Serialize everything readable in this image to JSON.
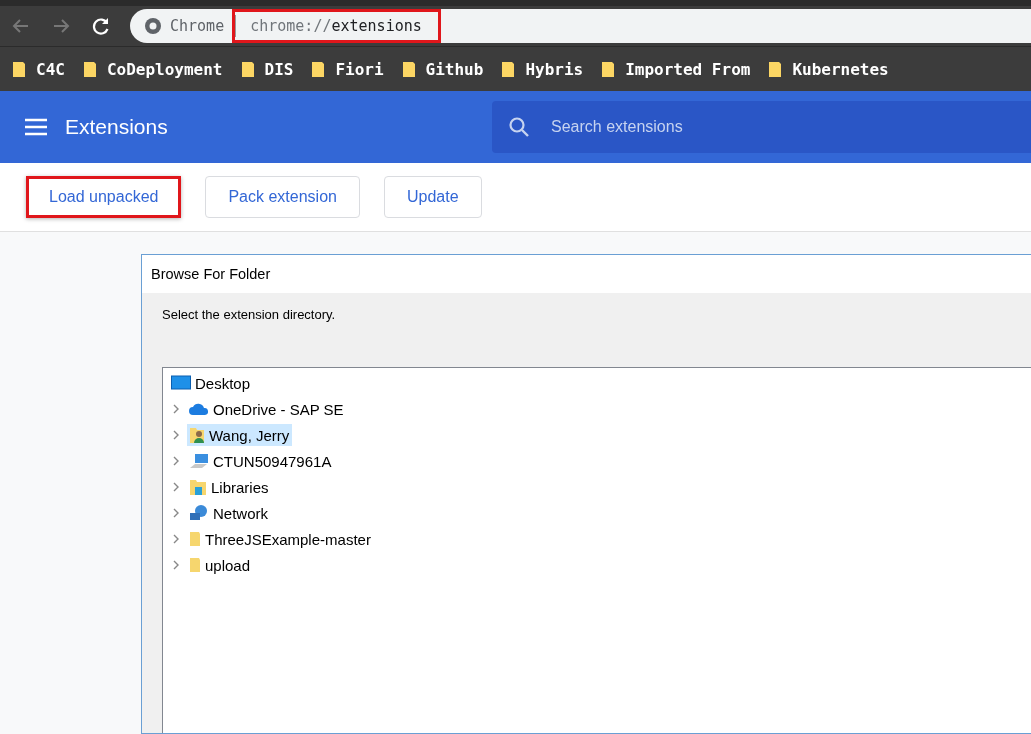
{
  "browser": {
    "site_label": "Chrome",
    "url_scheme": "chrome://",
    "url_path": "extensions",
    "url_highlighted": true
  },
  "bookmarks": [
    "C4C",
    "CoDeployment",
    "DIS",
    "Fiori",
    "Github",
    "Hybris",
    "Imported From",
    "Kubernetes"
  ],
  "header": {
    "title": "Extensions",
    "search": {
      "placeholder": "Search extensions"
    }
  },
  "buttons": [
    {
      "label": "Load unpacked",
      "highlighted": true
    },
    {
      "label": "Pack extension",
      "highlighted": false
    },
    {
      "label": "Update",
      "highlighted": false
    }
  ],
  "dialog": {
    "title": "Browse For Folder",
    "prompt": "Select the extension directory.",
    "tree": [
      {
        "label": "Desktop",
        "kind": "desktop",
        "selected": false,
        "children": [
          {
            "label": "OneDrive - SAP SE",
            "kind": "cloud",
            "selected": false,
            "expanded": false
          },
          {
            "label": "Wang, Jerry",
            "kind": "user",
            "selected": true,
            "expanded": false
          },
          {
            "label": "CTUN50947961A",
            "kind": "computer",
            "selected": false,
            "expanded": false
          },
          {
            "label": "Libraries",
            "kind": "libraries",
            "selected": false,
            "expanded": false
          },
          {
            "label": "Network",
            "kind": "network",
            "selected": false,
            "expanded": false
          },
          {
            "label": "ThreeJSExample-master",
            "kind": "folder",
            "selected": false,
            "expanded": false
          },
          {
            "label": "upload",
            "kind": "folder",
            "selected": false,
            "expanded": false
          }
        ]
      }
    ]
  }
}
